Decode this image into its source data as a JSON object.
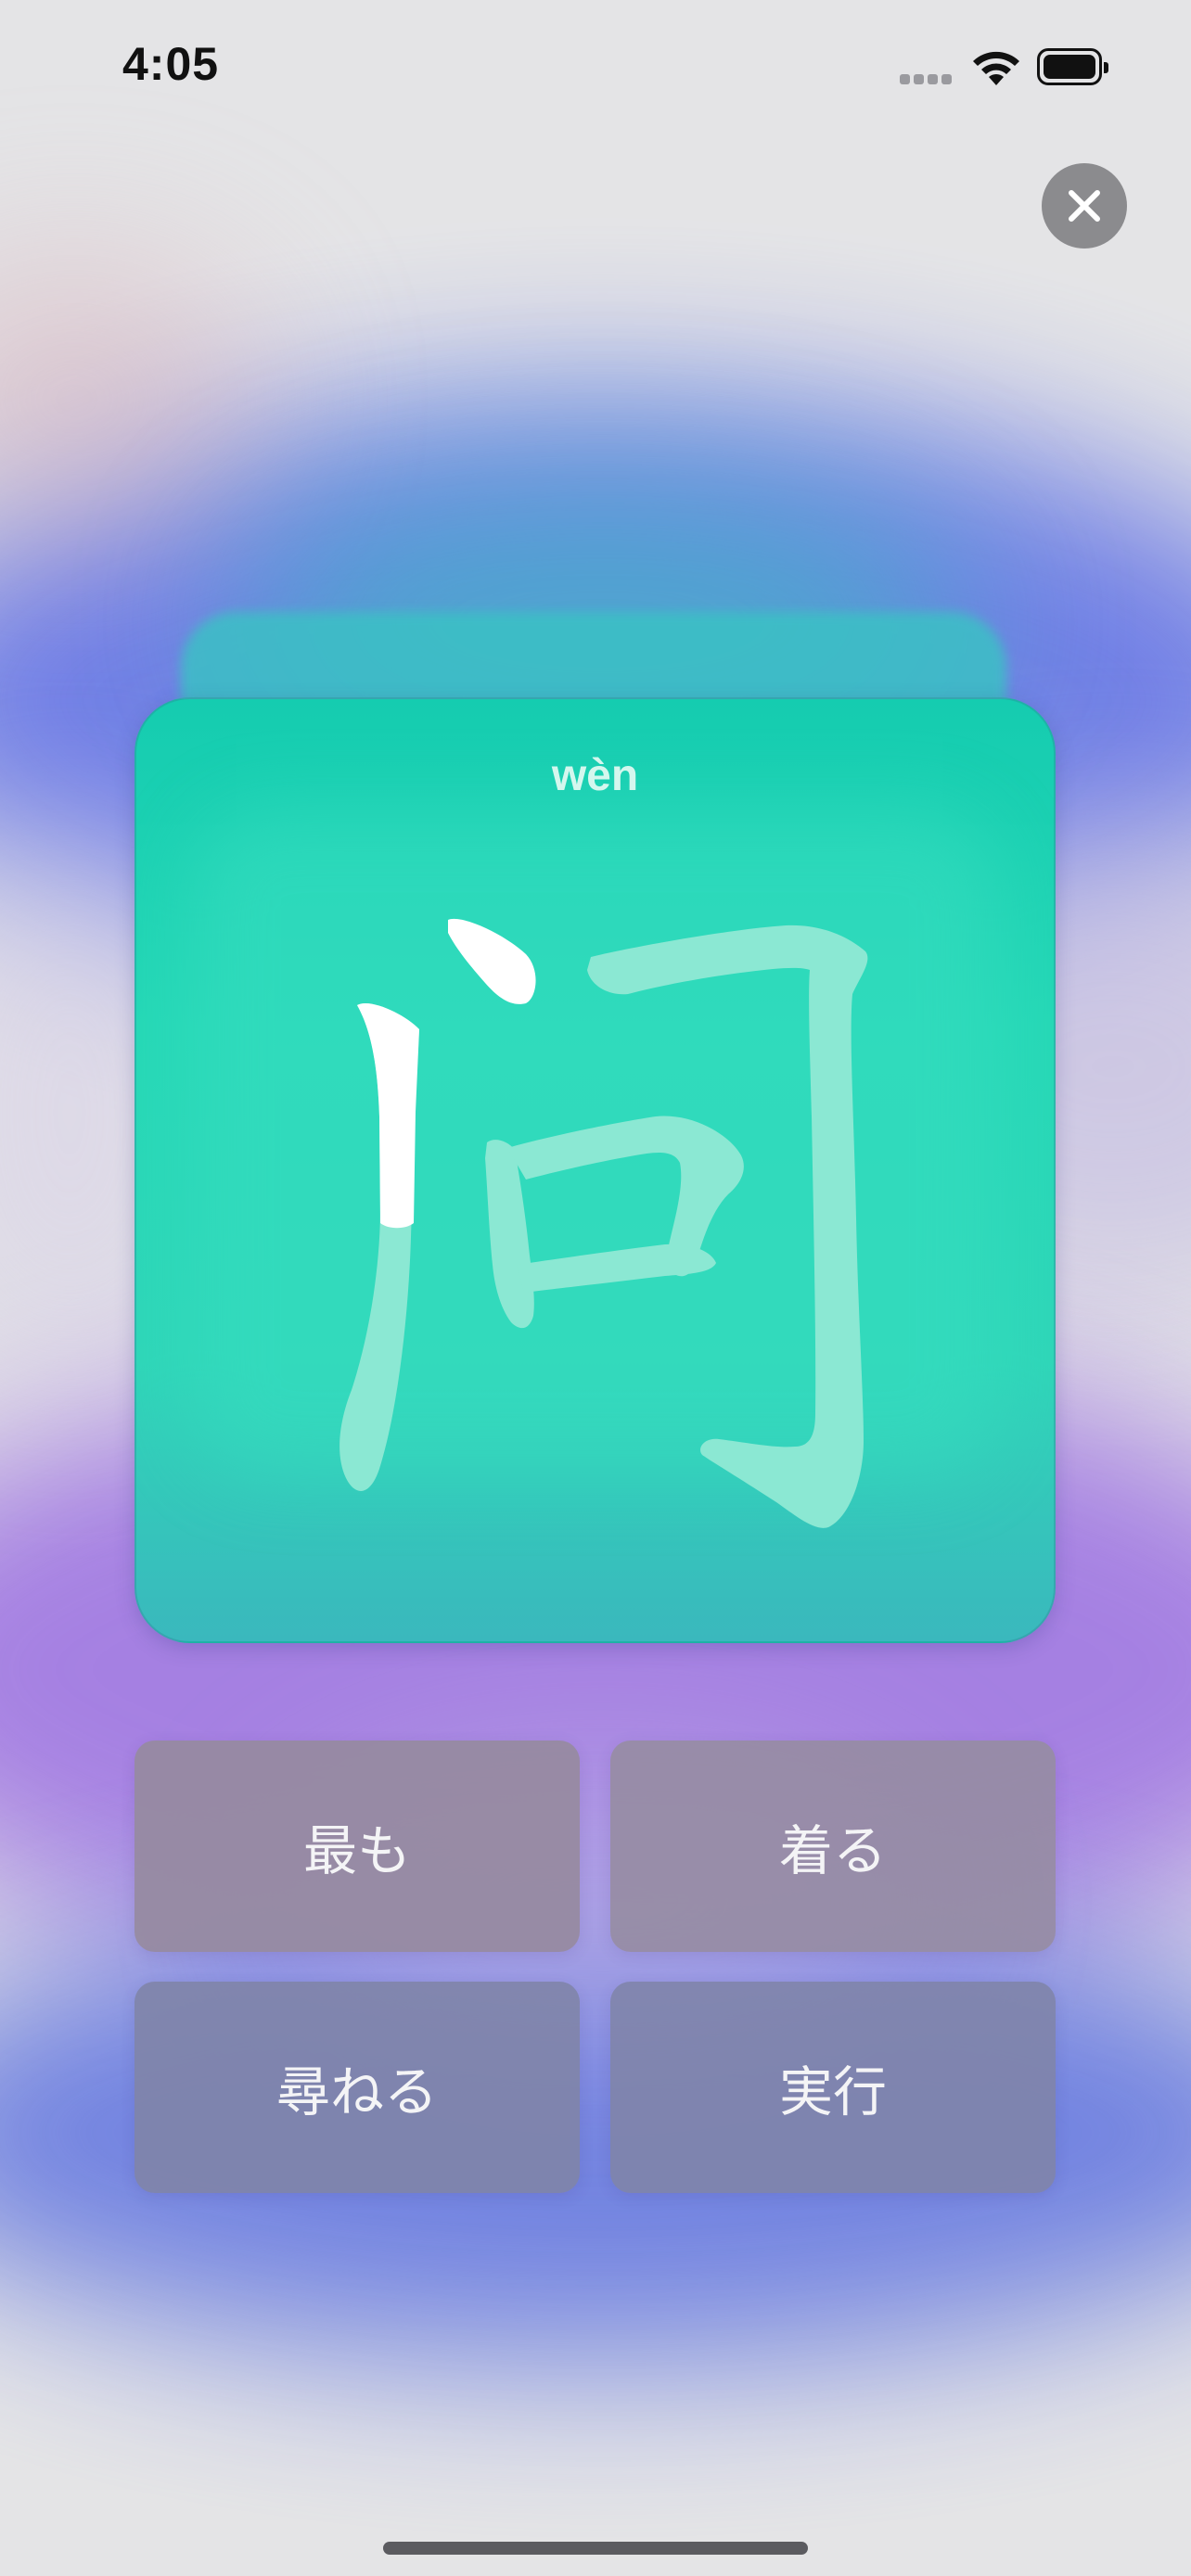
{
  "status_bar": {
    "time": "4:05",
    "icons": [
      "signal-icon",
      "wifi-icon",
      "battery-icon"
    ]
  },
  "close_button": {
    "icon": "close-icon"
  },
  "flashcard": {
    "pinyin": "wèn",
    "character": "问",
    "stroke_progress": "1 of 6 strokes drawn, second stroke partially traced"
  },
  "answers": [
    {
      "label": "最も"
    },
    {
      "label": "着る"
    },
    {
      "label": "尋ねる"
    },
    {
      "label": "実行"
    }
  ],
  "colors": {
    "card_top": "#15ccb0",
    "card_bottom": "#3ab8bd",
    "stroke_done": "#ffffff",
    "stroke_pending": "#8be8d3",
    "close_button": "#8b8b8e"
  }
}
